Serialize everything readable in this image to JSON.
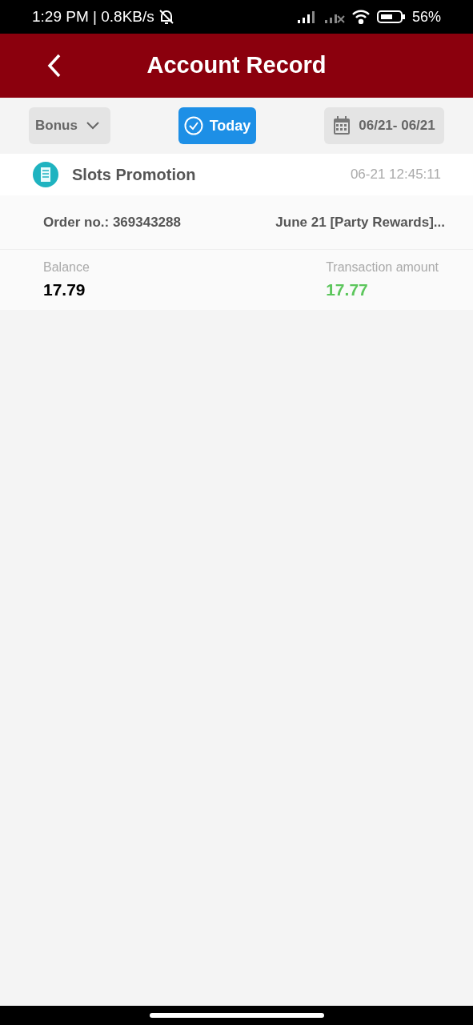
{
  "status_bar": {
    "time": "1:29 PM | 0.8KB/s",
    "battery": "56%"
  },
  "header": {
    "title": "Account Record"
  },
  "filters": {
    "category": "Bonus",
    "today": {
      "label": "Today",
      "selected": true
    },
    "date_range": "06/21- 06/21"
  },
  "records": [
    {
      "title": "Slots Promotion",
      "time": "06-21 12:45:11",
      "order": "Order no.: 369343288",
      "description": "June 21 [Party Rewards]...",
      "balance_label": "Balance",
      "balance": "17.79",
      "amount_label": "Transaction amount",
      "amount": "17.77",
      "kind": "income"
    }
  ]
}
